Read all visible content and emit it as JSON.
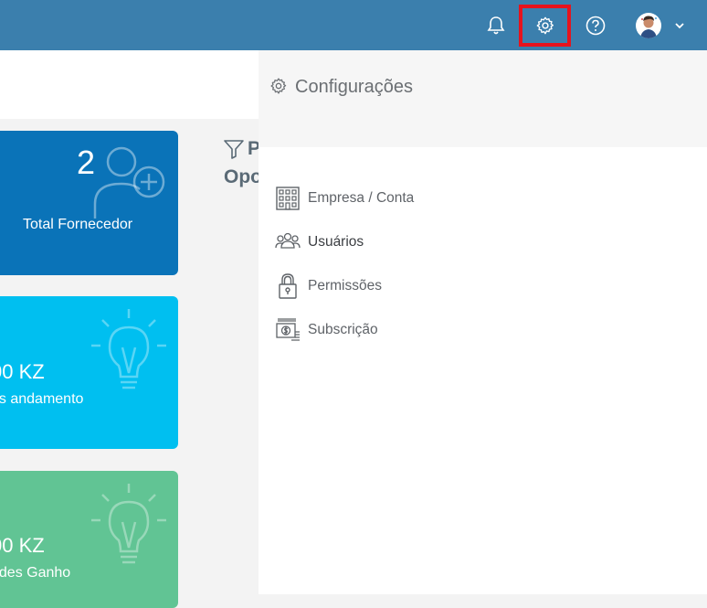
{
  "topbar": {
    "notifications_icon": "bell-icon",
    "settings_icon": "gear-icon",
    "help_icon": "question-circle-icon",
    "user_menu_icon": "chevron-down-icon",
    "colors": {
      "bar": "#3b7fad",
      "highlight": "#e6131d"
    }
  },
  "cards": [
    {
      "value": "2",
      "label": "Total Fornecedor",
      "icon": "add-user-icon",
      "color": "#0a73b8"
    },
    {
      "value": "00 KZ",
      "label": "es andamento",
      "icon": "lightbulb-icon",
      "color": "#00bff0"
    },
    {
      "value": "00 KZ",
      "label": "ades Ganho",
      "icon": "lightbulb-icon",
      "color": "#61c494"
    }
  ],
  "filter": {
    "line1": "P",
    "line2": "Opo",
    "icon": "filter-icon"
  },
  "settings_menu": {
    "title": "Configurações",
    "items": [
      {
        "label": "Empresa / Conta",
        "icon": "building-icon"
      },
      {
        "label": "Usuários",
        "icon": "users-icon"
      },
      {
        "label": "Permissões",
        "icon": "lock-icon"
      },
      {
        "label": "Subscrição",
        "icon": "money-icon"
      }
    ]
  }
}
